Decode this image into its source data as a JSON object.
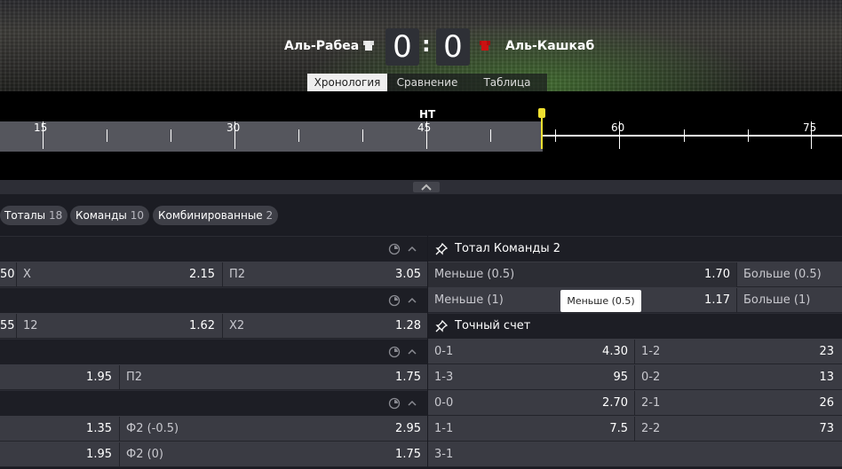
{
  "header": {
    "team1": "Аль-Рабеа",
    "team2": "Аль-Кашкаб",
    "score1": "0",
    "score2": "0",
    "tabs": [
      "Хронология",
      "Сравнение",
      "Таблица"
    ],
    "colors": {
      "team1_shirt": "#ffffff",
      "team2_shirt": "#cc1111"
    }
  },
  "timeline": {
    "ht_label": "HT",
    "labels": [
      "15",
      "30",
      "45",
      "60",
      "75"
    ],
    "current_minute_marker": "yellow"
  },
  "filters": [
    {
      "label": "Тоталы",
      "count": "18"
    },
    {
      "label": "Команды",
      "count": "10"
    },
    {
      "label": "Комбинированные",
      "count": "2"
    }
  ],
  "left_markets": {
    "row1": {
      "c0": "50",
      "l1": "X",
      "v1": "2.15",
      "l2": "П2",
      "v2": "3.05"
    },
    "row2": {
      "c0": "55",
      "l1": "12",
      "v1": "1.62",
      "l2": "X2",
      "v2": "1.28"
    },
    "row3": {
      "v1": "1.95",
      "l2": "П2",
      "v2": "1.75"
    },
    "row4": {
      "v1": "1.35",
      "l2": "Ф2 (-0.5)",
      "v2": "2.95"
    },
    "row5": {
      "v1": "1.95",
      "l2": "Ф2 (0)",
      "v2": "1.75"
    }
  },
  "team_total": {
    "title": "Тотал Команды 2",
    "rows": [
      {
        "l1": "Меньше (0.5)",
        "v1": "1.70",
        "l2": "Больше (0.5)"
      },
      {
        "l1": "Меньше (1)",
        "v1": "1.17",
        "l2": "Больше (1)"
      }
    ],
    "tooltip": "Меньше  (0.5)"
  },
  "exact_score": {
    "title": "Точный счет",
    "rows": [
      {
        "l1": "0-1",
        "v1": "4.30",
        "l2": "1-2",
        "v2": "23"
      },
      {
        "l1": "1-3",
        "v1": "95",
        "l2": "0-2",
        "v2": "13"
      },
      {
        "l1": "0-0",
        "v1": "2.70",
        "l2": "2-1",
        "v2": "26"
      },
      {
        "l1": "1-1",
        "v1": "7.5",
        "l2": "2-2",
        "v2": "73"
      },
      {
        "l1": "3-1"
      }
    ]
  }
}
